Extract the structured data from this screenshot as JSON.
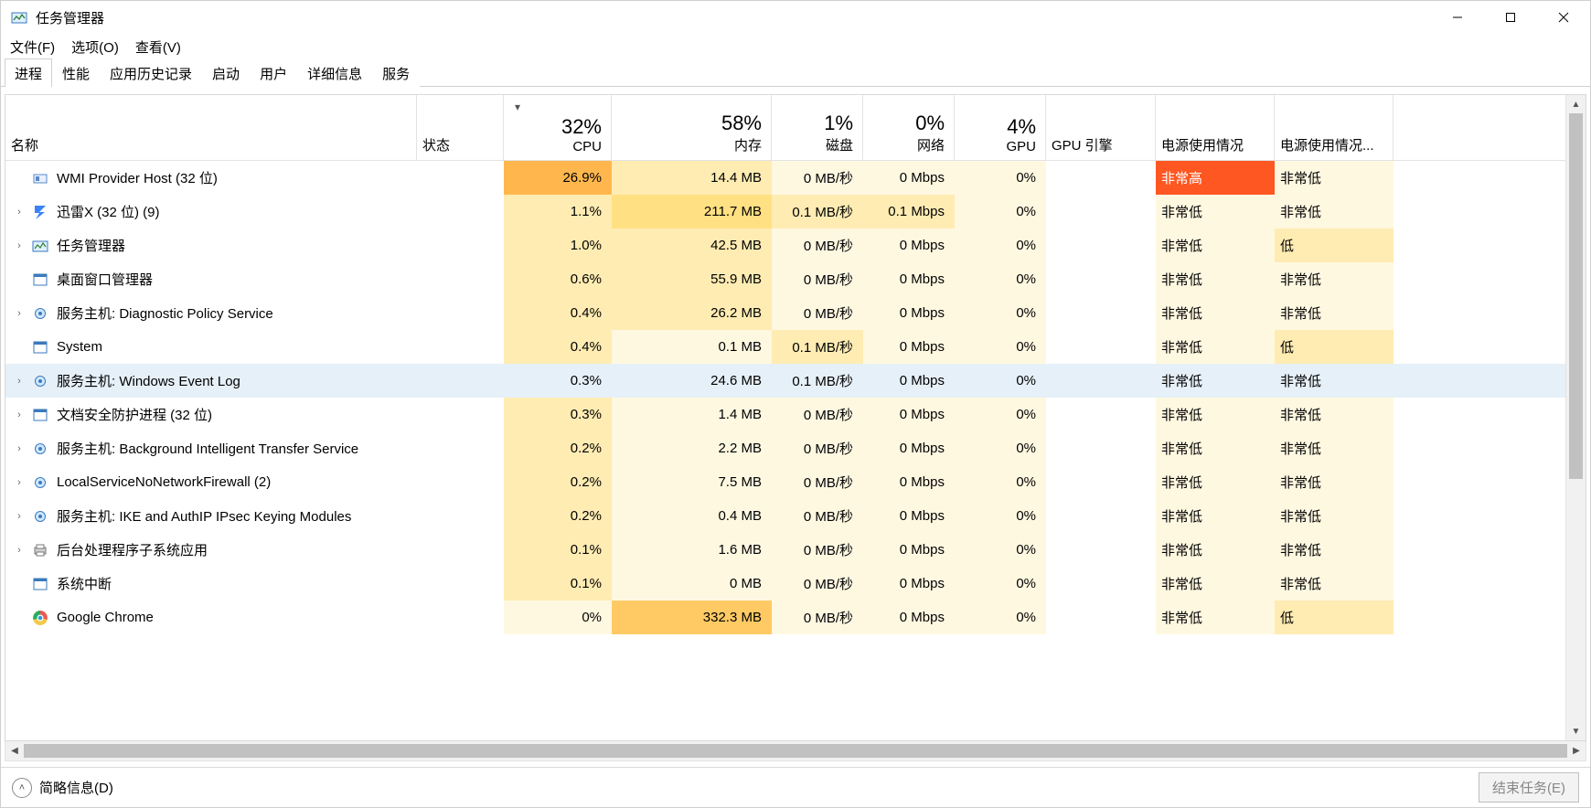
{
  "window": {
    "title": "任务管理器"
  },
  "menu": {
    "file": "文件(F)",
    "options": "选项(O)",
    "view": "查看(V)"
  },
  "tabs": [
    "进程",
    "性能",
    "应用历史记录",
    "启动",
    "用户",
    "详细信息",
    "服务"
  ],
  "active_tab": 0,
  "columns": {
    "name": "名称",
    "status": "状态",
    "cpu": {
      "usage": "32%",
      "label": "CPU"
    },
    "memory": {
      "usage": "58%",
      "label": "内存"
    },
    "disk": {
      "usage": "1%",
      "label": "磁盘"
    },
    "network": {
      "usage": "0%",
      "label": "网络"
    },
    "gpu": {
      "usage": "4%",
      "label": "GPU"
    },
    "gpu_engine": "GPU 引擎",
    "power": "电源使用情况",
    "power_trend": "电源使用情况..."
  },
  "sort": {
    "column": "cpu",
    "direction": "desc"
  },
  "power_labels": {
    "very_high": "非常高",
    "very_low": "非常低",
    "low": "低"
  },
  "rows": [
    {
      "icon": "service",
      "name": "WMI Provider Host (32 位)",
      "expandable": false,
      "cpu": "26.9%",
      "mem": "14.4 MB",
      "disk": "0 MB/秒",
      "net": "0 Mbps",
      "gpu": "0%",
      "gpue": "",
      "pow": "非常高",
      "powt": "非常低",
      "heat": {
        "cpu": "h4",
        "mem": "h1",
        "disk": "h0",
        "net": "h0",
        "gpu": "h0",
        "pow": "hhot",
        "powt": "h0"
      }
    },
    {
      "icon": "xunlei",
      "name": "迅雷X (32 位) (9)",
      "expandable": true,
      "cpu": "1.1%",
      "mem": "211.7 MB",
      "disk": "0.1 MB/秒",
      "net": "0.1 Mbps",
      "gpu": "0%",
      "gpue": "",
      "pow": "非常低",
      "powt": "非常低",
      "heat": {
        "cpu": "h1",
        "mem": "h2",
        "disk": "h1",
        "net": "h1",
        "gpu": "h0",
        "pow": "h0",
        "powt": "h0"
      }
    },
    {
      "icon": "taskmgr",
      "name": "任务管理器",
      "expandable": true,
      "cpu": "1.0%",
      "mem": "42.5 MB",
      "disk": "0 MB/秒",
      "net": "0 Mbps",
      "gpu": "0%",
      "gpue": "",
      "pow": "非常低",
      "powt": "低",
      "heat": {
        "cpu": "h1",
        "mem": "h1",
        "disk": "h0",
        "net": "h0",
        "gpu": "h0",
        "pow": "h0",
        "powt": "h1"
      }
    },
    {
      "icon": "dwm",
      "name": "桌面窗口管理器",
      "expandable": false,
      "cpu": "0.6%",
      "mem": "55.9 MB",
      "disk": "0 MB/秒",
      "net": "0 Mbps",
      "gpu": "0%",
      "gpue": "",
      "pow": "非常低",
      "powt": "非常低",
      "heat": {
        "cpu": "h1",
        "mem": "h1",
        "disk": "h0",
        "net": "h0",
        "gpu": "h0",
        "pow": "h0",
        "powt": "h0"
      }
    },
    {
      "icon": "gear",
      "name": "服务主机: Diagnostic Policy Service",
      "expandable": true,
      "cpu": "0.4%",
      "mem": "26.2 MB",
      "disk": "0 MB/秒",
      "net": "0 Mbps",
      "gpu": "0%",
      "gpue": "",
      "pow": "非常低",
      "powt": "非常低",
      "heat": {
        "cpu": "h1",
        "mem": "h1",
        "disk": "h0",
        "net": "h0",
        "gpu": "h0",
        "pow": "h0",
        "powt": "h0"
      }
    },
    {
      "icon": "dwm",
      "name": "System",
      "expandable": false,
      "cpu": "0.4%",
      "mem": "0.1 MB",
      "disk": "0.1 MB/秒",
      "net": "0 Mbps",
      "gpu": "0%",
      "gpue": "",
      "pow": "非常低",
      "powt": "低",
      "heat": {
        "cpu": "h1",
        "mem": "h0",
        "disk": "h1",
        "net": "h0",
        "gpu": "h0",
        "pow": "h0",
        "powt": "h1"
      }
    },
    {
      "icon": "gear",
      "name": "服务主机: Windows Event Log",
      "expandable": true,
      "selected": true,
      "cpu": "0.3%",
      "mem": "24.6 MB",
      "disk": "0.1 MB/秒",
      "net": "0 Mbps",
      "gpu": "0%",
      "gpue": "",
      "pow": "非常低",
      "powt": "非常低",
      "heat": {
        "cpu": "hsel",
        "mem": "hsel",
        "disk": "hsel",
        "net": "hsel",
        "gpu": "hsel",
        "pow": "hsel",
        "powt": "hsel"
      }
    },
    {
      "icon": "dwm",
      "name": "文档安全防护进程 (32 位)",
      "expandable": true,
      "cpu": "0.3%",
      "mem": "1.4 MB",
      "disk": "0 MB/秒",
      "net": "0 Mbps",
      "gpu": "0%",
      "gpue": "",
      "pow": "非常低",
      "powt": "非常低",
      "heat": {
        "cpu": "h1",
        "mem": "h0",
        "disk": "h0",
        "net": "h0",
        "gpu": "h0",
        "pow": "h0",
        "powt": "h0"
      }
    },
    {
      "icon": "gear",
      "name": "服务主机: Background Intelligent Transfer Service",
      "expandable": true,
      "cpu": "0.2%",
      "mem": "2.2 MB",
      "disk": "0 MB/秒",
      "net": "0 Mbps",
      "gpu": "0%",
      "gpue": "",
      "pow": "非常低",
      "powt": "非常低",
      "heat": {
        "cpu": "h1",
        "mem": "h0",
        "disk": "h0",
        "net": "h0",
        "gpu": "h0",
        "pow": "h0",
        "powt": "h0"
      }
    },
    {
      "icon": "gear",
      "name": "LocalServiceNoNetworkFirewall (2)",
      "expandable": true,
      "cpu": "0.2%",
      "mem": "7.5 MB",
      "disk": "0 MB/秒",
      "net": "0 Mbps",
      "gpu": "0%",
      "gpue": "",
      "pow": "非常低",
      "powt": "非常低",
      "heat": {
        "cpu": "h1",
        "mem": "h0",
        "disk": "h0",
        "net": "h0",
        "gpu": "h0",
        "pow": "h0",
        "powt": "h0"
      }
    },
    {
      "icon": "gear",
      "name": "服务主机: IKE and AuthIP IPsec Keying Modules",
      "expandable": true,
      "cpu": "0.2%",
      "mem": "0.4 MB",
      "disk": "0 MB/秒",
      "net": "0 Mbps",
      "gpu": "0%",
      "gpue": "",
      "pow": "非常低",
      "powt": "非常低",
      "heat": {
        "cpu": "h1",
        "mem": "h0",
        "disk": "h0",
        "net": "h0",
        "gpu": "h0",
        "pow": "h0",
        "powt": "h0"
      }
    },
    {
      "icon": "printer",
      "name": "后台处理程序子系统应用",
      "expandable": true,
      "cpu": "0.1%",
      "mem": "1.6 MB",
      "disk": "0 MB/秒",
      "net": "0 Mbps",
      "gpu": "0%",
      "gpue": "",
      "pow": "非常低",
      "powt": "非常低",
      "heat": {
        "cpu": "h1",
        "mem": "h0",
        "disk": "h0",
        "net": "h0",
        "gpu": "h0",
        "pow": "h0",
        "powt": "h0"
      }
    },
    {
      "icon": "dwm",
      "name": "系统中断",
      "expandable": false,
      "cpu": "0.1%",
      "mem": "0 MB",
      "disk": "0 MB/秒",
      "net": "0 Mbps",
      "gpu": "0%",
      "gpue": "",
      "pow": "非常低",
      "powt": "非常低",
      "heat": {
        "cpu": "h1",
        "mem": "h0",
        "disk": "h0",
        "net": "h0",
        "gpu": "h0",
        "pow": "h0",
        "powt": "h0"
      }
    },
    {
      "icon": "chrome",
      "name": "Google Chrome",
      "expandable": false,
      "cpu": "0%",
      "mem": "332.3 MB",
      "disk": "0 MB/秒",
      "net": "0 Mbps",
      "gpu": "0%",
      "gpue": "",
      "pow": "非常低",
      "powt": "低",
      "heat": {
        "cpu": "h0",
        "mem": "h3",
        "disk": "h0",
        "net": "h0",
        "gpu": "h0",
        "pow": "h0",
        "powt": "h1"
      }
    }
  ],
  "footer": {
    "fewer_details": "简略信息(D)",
    "end_task": "结束任务(E)"
  }
}
